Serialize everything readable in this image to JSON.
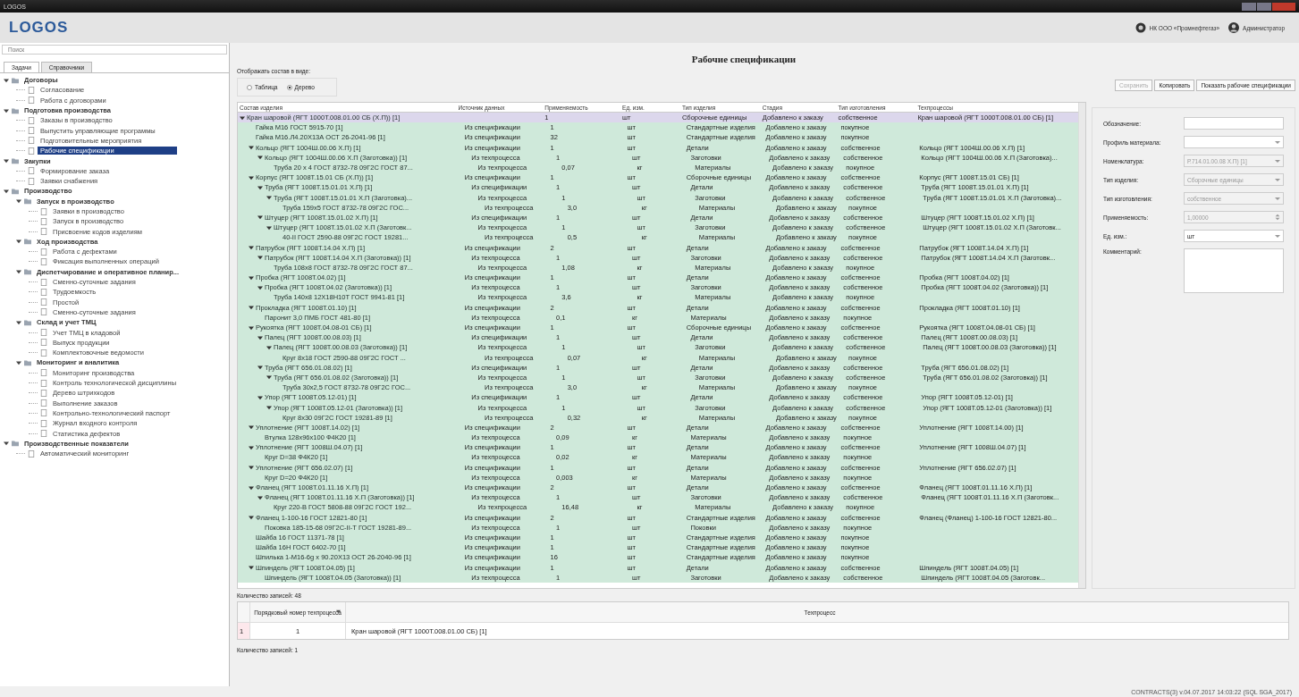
{
  "window": {
    "title": "LOGOS"
  },
  "header": {
    "logo": "LOGOS",
    "organization": "НК ООО «Промнефтегаз»",
    "user": "Администратор"
  },
  "sidebar": {
    "search": {
      "placeholder": "Поиск"
    },
    "tabs": [
      {
        "label": "Задачи",
        "selected": true
      },
      {
        "label": "Справочники",
        "selected": false
      }
    ],
    "tree": [
      {
        "label": "Договоры",
        "expanded": true,
        "selected": false,
        "children": [
          {
            "label": "Согласование",
            "selected": false
          },
          {
            "label": "Работа с договорами",
            "selected": false
          }
        ]
      },
      {
        "label": "Подготовка производства",
        "expanded": true,
        "selected": false,
        "children": [
          {
            "label": "Заказы в производство",
            "selected": false
          },
          {
            "label": "Выпустить управляющие программы",
            "selected": false
          },
          {
            "label": "Подготовительные мероприятия",
            "selected": false
          },
          {
            "label": "Рабочие спецификации",
            "selected": true
          }
        ]
      },
      {
        "label": "Закупки",
        "expanded": true,
        "selected": false,
        "children": [
          {
            "label": "Формирование заказа",
            "selected": false
          },
          {
            "label": "Заявки снабжения",
            "selected": false
          }
        ]
      },
      {
        "label": "Производство",
        "expanded": true,
        "selected": false,
        "children": [
          {
            "label": "Запуск в производство",
            "expanded": true,
            "selected": false,
            "children": [
              {
                "label": "Заявки в производство",
                "selected": false
              },
              {
                "label": "Запуск в производство",
                "selected": false
              },
              {
                "label": "Присвоение кодов изделиям",
                "selected": false
              }
            ]
          },
          {
            "label": "Ход производства",
            "expanded": true,
            "selected": false,
            "children": [
              {
                "label": "Работа с дефектами",
                "selected": false
              },
              {
                "label": "Фиксация выполненных операций",
                "selected": false
              }
            ]
          },
          {
            "label": "Диспетчирование и оперативное планир...",
            "expanded": true,
            "selected": false,
            "children": [
              {
                "label": "Сменно-суточные задания",
                "selected": false
              },
              {
                "label": "Трудоемкость",
                "selected": false
              },
              {
                "label": "Простой",
                "selected": false
              },
              {
                "label": "Сменно-суточные задания",
                "selected": false
              }
            ]
          },
          {
            "label": "Склад и учет ТМЦ",
            "expanded": true,
            "selected": false,
            "children": [
              {
                "label": "Учет ТМЦ в кладовой",
                "selected": false
              },
              {
                "label": "Выпуск продукции",
                "selected": false
              },
              {
                "label": "Комплектовочные ведомости",
                "selected": false
              }
            ]
          },
          {
            "label": "Мониторинг и аналитика",
            "expanded": true,
            "selected": false,
            "children": [
              {
                "label": "Мониторинг производства",
                "selected": false
              },
              {
                "label": "Контроль технологической дисциплины",
                "selected": false
              },
              {
                "label": "Дерево штрихкодов",
                "selected": false
              },
              {
                "label": "Выполнение заказов",
                "selected": false
              },
              {
                "label": "Контрольно-технологический паспорт",
                "selected": false
              },
              {
                "label": "Журнал входного контроля",
                "selected": false
              },
              {
                "label": "Статистика дефектов",
                "selected": false
              }
            ]
          }
        ]
      },
      {
        "label": "Производственные показатели",
        "expanded": true,
        "selected": false,
        "children": [
          {
            "label": "Автоматический мониторинг",
            "selected": false
          }
        ]
      }
    ]
  },
  "page": {
    "title": "Рабочие спецификации",
    "view_label": "Отображать состав в виде:",
    "view_options": [
      {
        "label": "Таблица",
        "selected": false
      },
      {
        "label": "Дерево",
        "selected": true
      }
    ],
    "buttons": [
      {
        "label": "Сохранить",
        "disabled": true
      },
      {
        "label": "Копировать",
        "disabled": false
      },
      {
        "label": "Показать рабочие спецификации",
        "disabled": false
      }
    ]
  },
  "table": {
    "columns": [
      "Состав изделия",
      "Источник данных",
      "Применяемость",
      "Ед. изм.",
      "Тип изделия",
      "Стадия",
      "Тип изготовления",
      "Техпроцессы"
    ],
    "rows": [
      {
        "name": "Кран шаровой (ЯГТ 1000Т.008.01.00 СБ (Х.П)) [1]",
        "quantity": "1",
        "unit": "шт",
        "item_type": "Сборочные единицы",
        "stage": "Добавлено к заказу",
        "manufacture": "собственное",
        "process": "Кран шаровой (ЯГТ 1000Т.008.01.00 СБ) [1]",
        "expanded": true,
        "selected": true,
        "children": [
          {
            "name": "Гайка М16 ГОСТ 5915-70 [1]",
            "source": "Из спецификации",
            "quantity": "1",
            "unit": "шт",
            "item_type": "Стандартные изделия",
            "stage": "Добавлено к заказу",
            "manufacture": "покупное",
            "selected": false
          },
          {
            "name": "Гайка М16.Л4.20Х13А ОСТ 26-2041-96 [1]",
            "source": "Из спецификации",
            "quantity": "32",
            "unit": "шт",
            "item_type": "Стандартные изделия",
            "stage": "Добавлено к заказу",
            "manufacture": "покупное",
            "selected": false
          },
          {
            "name": "Кольцо (ЯГТ 1004Ш.00.06 Х.П) [1]",
            "source": "Из спецификации",
            "quantity": "1",
            "unit": "шт",
            "item_type": "Детали",
            "stage": "Добавлено к заказу",
            "manufacture": "собственное",
            "process": "Кольцо (ЯГТ 1004Ш.00.06 Х.П) [1]",
            "expanded": true,
            "selected": false,
            "children": [
              {
                "name": "Кольцо (ЯГТ 1004Ш.00.06 Х.П (Заготовка)) [1]",
                "source": "Из техпроцесса",
                "quantity": "1",
                "unit": "шт",
                "item_type": "Заготовки",
                "stage": "Добавлено к заказу",
                "manufacture": "собственное",
                "process": "Кольцо (ЯГТ 1004Ш.00.06 Х.П (Заготовка)...",
                "expanded": true,
                "selected": false,
                "children": [
                  {
                    "name": "Труба 20 х 4 ГОСТ 8732-78 09Г2С ГОСТ 87...",
                    "source": "Из техпроцесса",
                    "quantity": "0,07",
                    "unit": "кг",
                    "item_type": "Материалы",
                    "stage": "Добавлено к заказу",
                    "manufacture": "покупное",
                    "selected": false
                  }
                ]
              }
            ]
          },
          {
            "name": "Корпус (ЯГТ 1008Т.15.01 СБ (Х.П)) [1]",
            "source": "Из спецификации",
            "quantity": "1",
            "unit": "шт",
            "item_type": "Сборочные единицы",
            "stage": "Добавлено к заказу",
            "manufacture": "собственное",
            "process": "Корпус (ЯГТ 1008Т.15.01 СБ) [1]",
            "expanded": true,
            "selected": false,
            "children": [
              {
                "name": "Труба (ЯГТ 1008Т.15.01.01 Х.П) [1]",
                "source": "Из спецификации",
                "quantity": "1",
                "unit": "шт",
                "item_type": "Детали",
                "stage": "Добавлено к заказу",
                "manufacture": "собственное",
                "process": "Труба (ЯГТ 1008Т.15.01.01 Х.П) [1]",
                "expanded": true,
                "selected": false,
                "children": [
                  {
                    "name": "Труба (ЯГТ 1008Т.15.01.01 Х.П (Заготовка)...",
                    "source": "Из техпроцесса",
                    "quantity": "1",
                    "unit": "шт",
                    "item_type": "Заготовки",
                    "stage": "Добавлено к заказу",
                    "manufacture": "собственное",
                    "process": "Труба (ЯГТ 1008Т.15.01.01 Х.П (Заготовка)...",
                    "expanded": true,
                    "selected": false,
                    "children": [
                      {
                        "name": "Труба 159х5 ГОСТ 8732-78 09Г2С ГОС...",
                        "source": "Из техпроцесса",
                        "quantity": "3,0",
                        "unit": "кг",
                        "item_type": "Материалы",
                        "stage": "Добавлено к заказу",
                        "manufacture": "покупное",
                        "selected": false
                      }
                    ]
                  }
                ]
              },
              {
                "name": "Штуцер (ЯГТ 1008Т.15.01.02 Х.П) [1]",
                "source": "Из спецификации",
                "quantity": "1",
                "unit": "шт",
                "item_type": "Детали",
                "stage": "Добавлено к заказу",
                "manufacture": "собственное",
                "process": "Штуцер (ЯГТ 1008Т.15.01.02 Х.П) [1]",
                "expanded": true,
                "selected": false,
                "children": [
                  {
                    "name": "Штуцер (ЯГТ 1008Т.15.01.02 Х.П (Заготовк...",
                    "source": "Из техпроцесса",
                    "quantity": "1",
                    "unit": "шт",
                    "item_type": "Заготовки",
                    "stage": "Добавлено к заказу",
                    "manufacture": "собственное",
                    "process": "Штуцер (ЯГТ 1008Т.15.01.02 Х.П (Заготовк...",
                    "expanded": true,
                    "selected": false,
                    "children": [
                      {
                        "name": "40-II ГОСТ 2590-88 09Г2С ГОСТ 19281...",
                        "source": "Из техпроцесса",
                        "quantity": "0,5",
                        "unit": "кг",
                        "item_type": "Материалы",
                        "stage": "Добавлено к заказу",
                        "manufacture": "покупное",
                        "selected": false
                      }
                    ]
                  }
                ]
              }
            ]
          },
          {
            "name": "Патрубок (ЯГТ 1008Т.14.04 Х.П) [1]",
            "source": "Из спецификации",
            "quantity": "2",
            "unit": "шт",
            "item_type": "Детали",
            "stage": "Добавлено к заказу",
            "manufacture": "собственное",
            "process": "Патрубок (ЯГТ 1008Т.14.04 Х.П) [1]",
            "expanded": true,
            "selected": false,
            "children": [
              {
                "name": "Патрубок (ЯГТ 1008Т.14.04 Х.П (Заготовка)) [1]",
                "source": "Из техпроцесса",
                "quantity": "1",
                "unit": "шт",
                "item_type": "Заготовки",
                "stage": "Добавлено к заказу",
                "manufacture": "собственное",
                "process": "Патрубок (ЯГТ 1008Т.14.04 Х.П (Заготовк...",
                "expanded": true,
                "selected": false,
                "children": [
                  {
                    "name": "Труба 108х8 ГОСТ 8732-78 09Г2С ГОСТ 87...",
                    "source": "Из техпроцесса",
                    "quantity": "1,08",
                    "unit": "кг",
                    "item_type": "Материалы",
                    "stage": "Добавлено к заказу",
                    "manufacture": "покупное",
                    "selected": false
                  }
                ]
              }
            ]
          },
          {
            "name": "Пробка (ЯГТ 1008Т.04.02) [1]",
            "source": "Из спецификации",
            "quantity": "1",
            "unit": "шт",
            "item_type": "Детали",
            "stage": "Добавлено к заказу",
            "manufacture": "собственное",
            "process": "Пробка (ЯГТ 1008Т.04.02) [1]",
            "expanded": true,
            "selected": false,
            "children": [
              {
                "name": "Пробка (ЯГТ 1008Т.04.02 (Заготовка)) [1]",
                "source": "Из техпроцесса",
                "quantity": "1",
                "unit": "шт",
                "item_type": "Заготовки",
                "stage": "Добавлено к заказу",
                "manufacture": "собственное",
                "process": "Пробка (ЯГТ 1008Т.04.02 (Заготовка)) [1]",
                "expanded": true,
                "selected": false,
                "children": [
                  {
                    "name": "Труба 140х8 12Х18Н10Т ГОСТ 9941-81 [1]",
                    "source": "Из техпроцесса",
                    "quantity": "3,6",
                    "unit": "кг",
                    "item_type": "Материалы",
                    "stage": "Добавлено к заказу",
                    "manufacture": "покупное",
                    "selected": false
                  }
                ]
              }
            ]
          },
          {
            "name": "Прокладка (ЯГТ 1008Т.01.10) [1]",
            "source": "Из спецификации",
            "quantity": "2",
            "unit": "шт",
            "item_type": "Детали",
            "stage": "Добавлено к заказу",
            "manufacture": "собственное",
            "process": "Прокладка (ЯГТ 1008Т.01.10) [1]",
            "expanded": true,
            "selected": false,
            "children": [
              {
                "name": "Паронит 3,0 ПМБ ГОСТ 481-80 [1]",
                "source": "Из техпроцесса",
                "quantity": "0,1",
                "unit": "кг",
                "item_type": "Материалы",
                "stage": "Добавлено к заказу",
                "manufacture": "покупное",
                "selected": false
              }
            ]
          },
          {
            "name": "Рукоятка (ЯГТ 1008Т.04.08-01 СБ) [1]",
            "source": "Из спецификации",
            "quantity": "1",
            "unit": "шт",
            "item_type": "Сборочные единицы",
            "stage": "Добавлено к заказу",
            "manufacture": "собственное",
            "process": "Рукоятка (ЯГТ 1008Т.04.08-01 СБ) [1]",
            "expanded": true,
            "selected": false,
            "children": [
              {
                "name": "Палец (ЯГТ 1008Т.00.08.03) [1]",
                "source": "Из спецификации",
                "quantity": "1",
                "unit": "шт",
                "item_type": "Детали",
                "stage": "Добавлено к заказу",
                "manufacture": "собственное",
                "process": "Палец (ЯГТ 1008Т.00.08.03) [1]",
                "expanded": true,
                "selected": false,
                "children": [
                  {
                    "name": "Палец (ЯГТ 1008Т.00.08.03 (Заготовка)) [1]",
                    "source": "Из техпроцесса",
                    "quantity": "1",
                    "unit": "шт",
                    "item_type": "Заготовки",
                    "stage": "Добавлено к заказу",
                    "manufacture": "собственное",
                    "process": "Палец (ЯГТ 1008Т.00.08.03 (Заготовка)) [1]",
                    "expanded": true,
                    "selected": false,
                    "children": [
                      {
                        "name": "Круг 8х18 ГОСТ 2590-88 09Г2С ГОСТ ...",
                        "source": "Из техпроцесса",
                        "quantity": "0,07",
                        "unit": "кг",
                        "item_type": "Материалы",
                        "stage": "Добавлено к заказу",
                        "manufacture": "покупное",
                        "selected": false
                      }
                    ]
                  }
                ]
              },
              {
                "name": "Труба (ЯГТ 656.01.08.02) [1]",
                "source": "Из спецификации",
                "quantity": "1",
                "unit": "шт",
                "item_type": "Детали",
                "stage": "Добавлено к заказу",
                "manufacture": "собственное",
                "process": "Труба (ЯГТ 656.01.08.02) [1]",
                "expanded": true,
                "selected": false,
                "children": [
                  {
                    "name": "Труба (ЯГТ 656.01.08.02 (Заготовка)) [1]",
                    "source": "Из техпроцесса",
                    "quantity": "1",
                    "unit": "шт",
                    "item_type": "Заготовки",
                    "stage": "Добавлено к заказу",
                    "manufacture": "собственное",
                    "process": "Труба (ЯГТ 656.01.08.02 (Заготовка)) [1]",
                    "expanded": true,
                    "selected": false,
                    "children": [
                      {
                        "name": "Труба 30х2,5 ГОСТ 8732-78 09Г2С ГОС...",
                        "source": "Из техпроцесса",
                        "quantity": "3,0",
                        "unit": "кг",
                        "item_type": "Материалы",
                        "stage": "Добавлено к заказу",
                        "manufacture": "покупное",
                        "selected": false
                      }
                    ]
                  }
                ]
              },
              {
                "name": "Упор (ЯГТ 1008Т.05.12-01) [1]",
                "source": "Из спецификации",
                "quantity": "1",
                "unit": "шт",
                "item_type": "Детали",
                "stage": "Добавлено к заказу",
                "manufacture": "собственное",
                "process": "Упор (ЯГТ 1008Т.05.12-01) [1]",
                "expanded": true,
                "selected": false,
                "children": [
                  {
                    "name": "Упор (ЯГТ 1008Т.05.12-01 (Заготовка)) [1]",
                    "source": "Из техпроцесса",
                    "quantity": "1",
                    "unit": "шт",
                    "item_type": "Заготовки",
                    "stage": "Добавлено к заказу",
                    "manufacture": "собственное",
                    "process": "Упор (ЯГТ 1008Т.05.12-01 (Заготовка)) [1]",
                    "expanded": true,
                    "selected": false,
                    "children": [
                      {
                        "name": "Круг 8х30 09Г2С ГОСТ 19281-89 [1]",
                        "source": "Из техпроцесса",
                        "quantity": "0,32",
                        "unit": "кг",
                        "item_type": "Материалы",
                        "stage": "Добавлено к заказу",
                        "manufacture": "покупное",
                        "selected": false
                      }
                    ]
                  }
                ]
              }
            ]
          },
          {
            "name": "Уплотнение (ЯГТ 1008Т.14.02) [1]",
            "source": "Из спецификации",
            "quantity": "2",
            "unit": "шт",
            "item_type": "Детали",
            "stage": "Добавлено к заказу",
            "manufacture": "собственное",
            "process": "Уплотнение (ЯГТ 1008Т.14.00) [1]",
            "expanded": true,
            "selected": false,
            "children": [
              {
                "name": "Втулка 128х96х100 Ф4К20 [1]",
                "source": "Из техпроцесса",
                "quantity": "0,09",
                "unit": "кг",
                "item_type": "Материалы",
                "stage": "Добавлено к заказу",
                "manufacture": "покупное",
                "selected": false
              }
            ]
          },
          {
            "name": "Уплотнение (ЯГТ 1008Ш.04.07) [1]",
            "source": "Из спецификации",
            "quantity": "1",
            "unit": "шт",
            "item_type": "Детали",
            "stage": "Добавлено к заказу",
            "manufacture": "собственное",
            "process": "Уплотнение (ЯГТ 1008Ш.04.07) [1]",
            "expanded": true,
            "selected": false,
            "children": [
              {
                "name": "Круг D=38 Ф4К20 [1]",
                "source": "Из техпроцесса",
                "quantity": "0,02",
                "unit": "кг",
                "item_type": "Материалы",
                "stage": "Добавлено к заказу",
                "manufacture": "покупное",
                "selected": false
              }
            ]
          },
          {
            "name": "Уплотнение (ЯГТ 656.02.07) [1]",
            "source": "Из спецификации",
            "quantity": "1",
            "unit": "шт",
            "item_type": "Детали",
            "stage": "Добавлено к заказу",
            "manufacture": "собственное",
            "process": "Уплотнение (ЯГТ 656.02.07) [1]",
            "expanded": true,
            "selected": false,
            "children": [
              {
                "name": "Круг D=20 Ф4К20 [1]",
                "source": "Из техпроцесса",
                "quantity": "0,003",
                "unit": "кг",
                "item_type": "Материалы",
                "stage": "Добавлено к заказу",
                "manufacture": "покупное",
                "selected": false
              }
            ]
          },
          {
            "name": "Фланец (ЯГТ 1008Т.01.11.16 Х.П) [1]",
            "source": "Из спецификации",
            "quantity": "2",
            "unit": "шт",
            "item_type": "Детали",
            "stage": "Добавлено к заказу",
            "manufacture": "собственное",
            "process": "Фланец (ЯГТ 1008Т.01.11.16 Х.П) [1]",
            "expanded": true,
            "selected": false,
            "children": [
              {
                "name": "Фланец (ЯГТ 1008Т.01.11.16 Х.П (Заготовка)) [1]",
                "source": "Из техпроцесса",
                "quantity": "1",
                "unit": "шт",
                "item_type": "Заготовки",
                "stage": "Добавлено к заказу",
                "manufacture": "собственное",
                "process": "Фланец (ЯГТ 1008Т.01.11.16 Х.П (Заготовк...",
                "expanded": true,
                "selected": false,
                "children": [
                  {
                    "name": "Круг 220-В ГОСТ 5808-88 09Г2С ГОСТ 192...",
                    "source": "Из техпроцесса",
                    "quantity": "16,48",
                    "unit": "кг",
                    "item_type": "Материалы",
                    "stage": "Добавлено к заказу",
                    "manufacture": "покупное",
                    "selected": false
                  }
                ]
              }
            ]
          },
          {
            "name": "Фланец 1-100-16 ГОСТ 12821-80 [1]",
            "source": "Из спецификации",
            "quantity": "2",
            "unit": "шт",
            "item_type": "Стандартные изделия",
            "stage": "Добавлено к заказу",
            "manufacture": "собственное",
            "process": "Фланец (Фланец) 1-100-16 ГОСТ 12821-80...",
            "expanded": true,
            "selected": false,
            "children": [
              {
                "name": "Поковка 185-15-68 09Г2С-II-Т ГОСТ 19281-89...",
                "source": "Из техпроцесса",
                "quantity": "1",
                "unit": "шт",
                "item_type": "Поковки",
                "stage": "Добавлено к заказу",
                "manufacture": "покупное",
                "selected": false
              }
            ]
          },
          {
            "name": "Шайба 16 ГОСТ 11371-78 [1]",
            "source": "Из спецификации",
            "quantity": "1",
            "unit": "шт",
            "item_type": "Стандартные изделия",
            "stage": "Добавлено к заказу",
            "manufacture": "покупное",
            "selected": false
          },
          {
            "name": "Шайба 16Н ГОСТ 6402-70 [1]",
            "source": "Из спецификации",
            "quantity": "1",
            "unit": "шт",
            "item_type": "Стандартные изделия",
            "stage": "Добавлено к заказу",
            "manufacture": "покупное",
            "selected": false
          },
          {
            "name": "Шпилька 1-М16-6g х 90.20Х13 ОСТ 26-2040-96 [1]",
            "source": "Из спецификации",
            "quantity": "16",
            "unit": "шт",
            "item_type": "Стандартные изделия",
            "stage": "Добавлено к заказу",
            "manufacture": "покупное",
            "selected": false
          },
          {
            "name": "Шпиндель (ЯГТ 1008Т.04.05) [1]",
            "source": "Из спецификации",
            "quantity": "1",
            "unit": "шт",
            "item_type": "Детали",
            "stage": "Добавлено к заказу",
            "manufacture": "собственное",
            "process": "Шпиндель (ЯГТ 1008Т.04.05) [1]",
            "expanded": true,
            "selected": false,
            "children": [
              {
                "name": "Шпиндель (ЯГТ 1008Т.04.05 (Заготовка)) [1]",
                "source": "Из техпроцесса",
                "quantity": "1",
                "unit": "шт",
                "item_type": "Заготовки",
                "stage": "Добавлено к заказу",
                "manufacture": "собственное",
                "process": "Шпиндель (ЯГТ 1008Т.04.05 (Заготовк...",
                "selected": false
              }
            ]
          }
        ]
      }
    ]
  },
  "record_count": "Количество записей: 48",
  "properties": {
    "fields": [
      {
        "label": "Обозначение:",
        "kind": "input",
        "disabled": false
      },
      {
        "label": "Профиль материала:",
        "kind": "select",
        "disabled": false
      },
      {
        "label": "Номенклатура:",
        "kind": "select",
        "value": "Р.714.01.00.08 Х.П) [1]",
        "disabled": true
      },
      {
        "label": "Тип изделия:",
        "kind": "select",
        "value": "Сборочные единицы",
        "disabled": true
      },
      {
        "label": "Тип изготовления:",
        "kind": "select",
        "value": "собственное",
        "disabled": true
      },
      {
        "label": "Применяемость:",
        "kind": "spin",
        "value": "1,00000",
        "disabled": true
      },
      {
        "label": "Ед. изм.:",
        "kind": "select",
        "value": "шт",
        "disabled": false
      },
      {
        "label": "Комментарий:",
        "kind": "textarea",
        "disabled": false
      }
    ]
  },
  "processes": {
    "columns": [
      "Порядковый номер техпроцесса",
      "Техпроцесс"
    ],
    "rows": [
      {
        "row_header": "1",
        "number": "1",
        "process": "Кран шаровой (ЯГТ 1000Т.008.01.00 СБ) [1]",
        "selected": false
      }
    ],
    "record_count": "Количество записей: 1"
  },
  "status_bar": "CONTRACTS(3) v.04.07.2017 14:03:22 (SQL SGA_2017)"
}
